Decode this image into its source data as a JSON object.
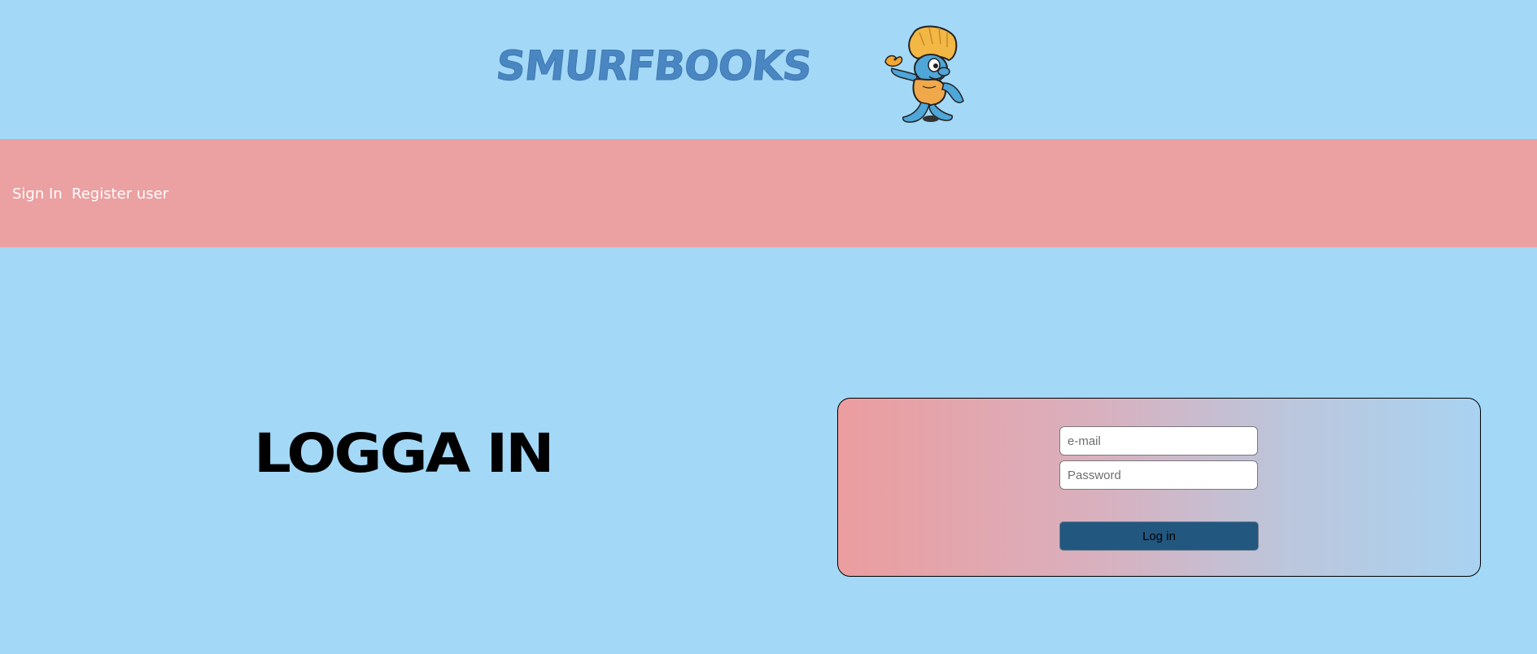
{
  "header": {
    "brand": "SMURFBOOKS",
    "mascot_icon": "smurf-mascot-icon"
  },
  "nav": {
    "items": [
      {
        "label": "Sign In"
      },
      {
        "label": "Register user"
      }
    ]
  },
  "main": {
    "heading": "LOGGA IN"
  },
  "login_form": {
    "email_placeholder": "e-mail",
    "password_placeholder": "Password",
    "submit_label": "Log in"
  },
  "colors": {
    "background": "#a3d8f7",
    "navbar": "#eba0a1",
    "brand_text": "#4a86c1",
    "button": "#22577f"
  }
}
